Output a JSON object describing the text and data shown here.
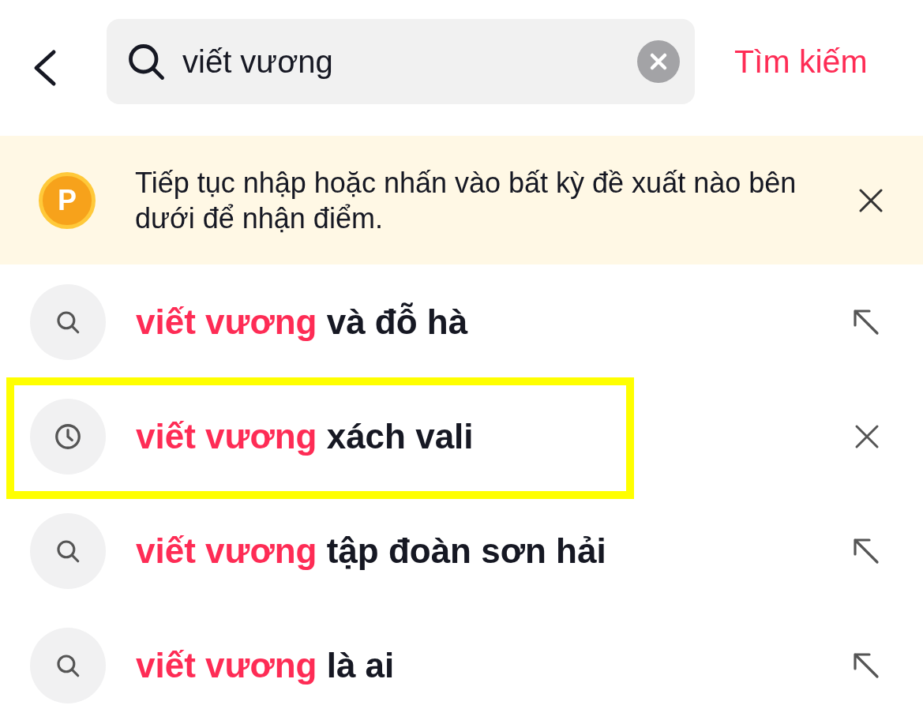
{
  "search": {
    "value": "viết vương",
    "submit_label": "Tìm kiếm"
  },
  "banner": {
    "text": "Tiếp tục nhập hoặc nhấn vào bất kỳ đề xuất nào bên dưới để nhận điểm.",
    "coin_label": "P"
  },
  "rows": [
    {
      "kind": "suggestion",
      "query": "viết vương",
      "rest": "và đỗ hà",
      "highlighted": false
    },
    {
      "kind": "history",
      "query": "viết vương",
      "rest": "xách vali",
      "highlighted": true
    },
    {
      "kind": "suggestion",
      "query": "viết vương",
      "rest": "tập đoàn sơn hải",
      "highlighted": false
    },
    {
      "kind": "suggestion",
      "query": "viết vương",
      "rest": "là ai",
      "highlighted": false
    }
  ]
}
